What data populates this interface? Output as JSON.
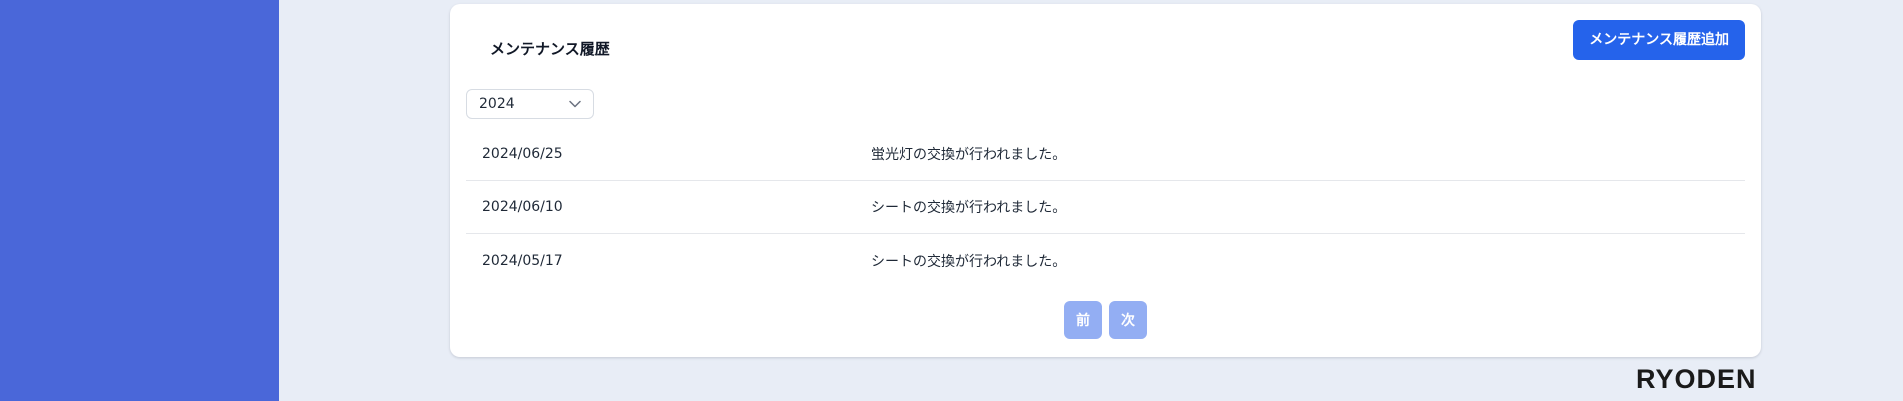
{
  "colors": {
    "sidebar": "#4a67d9",
    "background": "#e8edf6",
    "primary_button": "#2563eb",
    "pager_button_disabled": "#93aef3"
  },
  "maintenance": {
    "title": "メンテナンス履歴",
    "add_button_label": "メンテナンス履歴追加",
    "year_select": {
      "selected": "2024",
      "icon": "chevron-down-icon"
    },
    "records": [
      {
        "date": "2024/06/25",
        "description": "蛍光灯の交換が行われました。"
      },
      {
        "date": "2024/06/10",
        "description": "シートの交換が行われました。"
      },
      {
        "date": "2024/05/17",
        "description": "シートの交換が行われました。"
      }
    ],
    "pagination": {
      "prev_label": "前",
      "next_label": "次"
    }
  },
  "footer": {
    "brand": "RYODEN"
  }
}
